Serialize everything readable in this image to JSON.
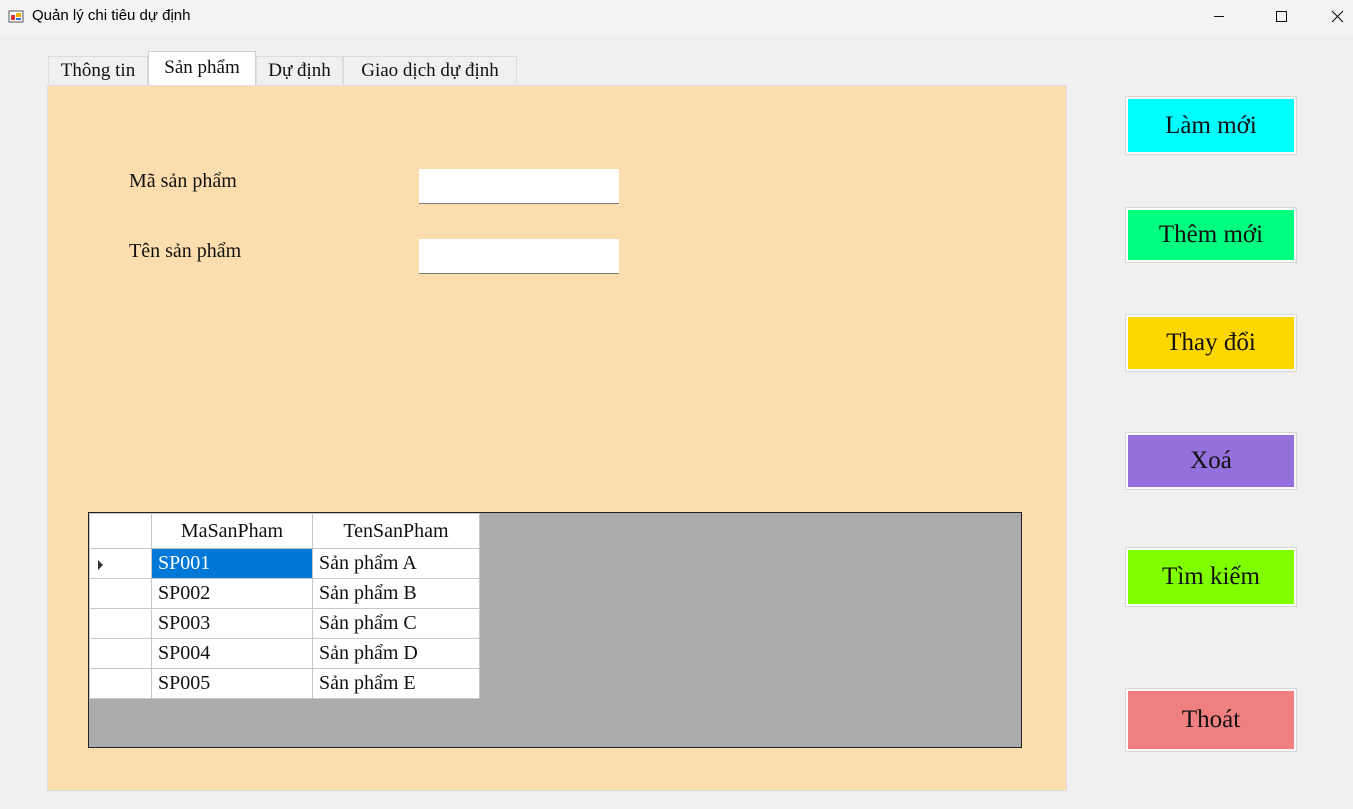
{
  "window": {
    "title": "Quản lý chi tiêu dự định"
  },
  "tabs": [
    {
      "label": "Thông tin"
    },
    {
      "label": "Sản phẩm"
    },
    {
      "label": "Dự định"
    },
    {
      "label": "Giao dịch dự định"
    }
  ],
  "active_tab_index": 1,
  "form": {
    "ma_label": "Mã sản phẩm",
    "ma_value": "",
    "ten_label": "Tên sản phẩm",
    "ten_value": ""
  },
  "grid": {
    "columns": [
      "MaSanPham",
      "TenSanPham"
    ],
    "rows": [
      [
        "SP001",
        "Sản phẩm A"
      ],
      [
        "SP002",
        "Sản phẩm B"
      ],
      [
        "SP003",
        "Sản phẩm C"
      ],
      [
        "SP004",
        "Sản phẩm D"
      ],
      [
        "SP005",
        "Sản phẩm E"
      ]
    ],
    "selected_row": 0
  },
  "buttons": {
    "refresh": {
      "label": "Làm mới",
      "color": "#00ffff"
    },
    "add": {
      "label": "Thêm mới",
      "color": "#00ff7f"
    },
    "edit": {
      "label": "Thay đổi",
      "color": "#ffd700"
    },
    "delete": {
      "label": "Xoá",
      "color": "#9370db"
    },
    "search": {
      "label": "Tìm kiếm",
      "color": "#7fff00"
    },
    "exit": {
      "label": "Thoát",
      "color": "#f08080"
    }
  },
  "colors": {
    "tab_page_background": "#fcdeae",
    "grid_background": "#ababab",
    "selection": "#0078d7"
  }
}
